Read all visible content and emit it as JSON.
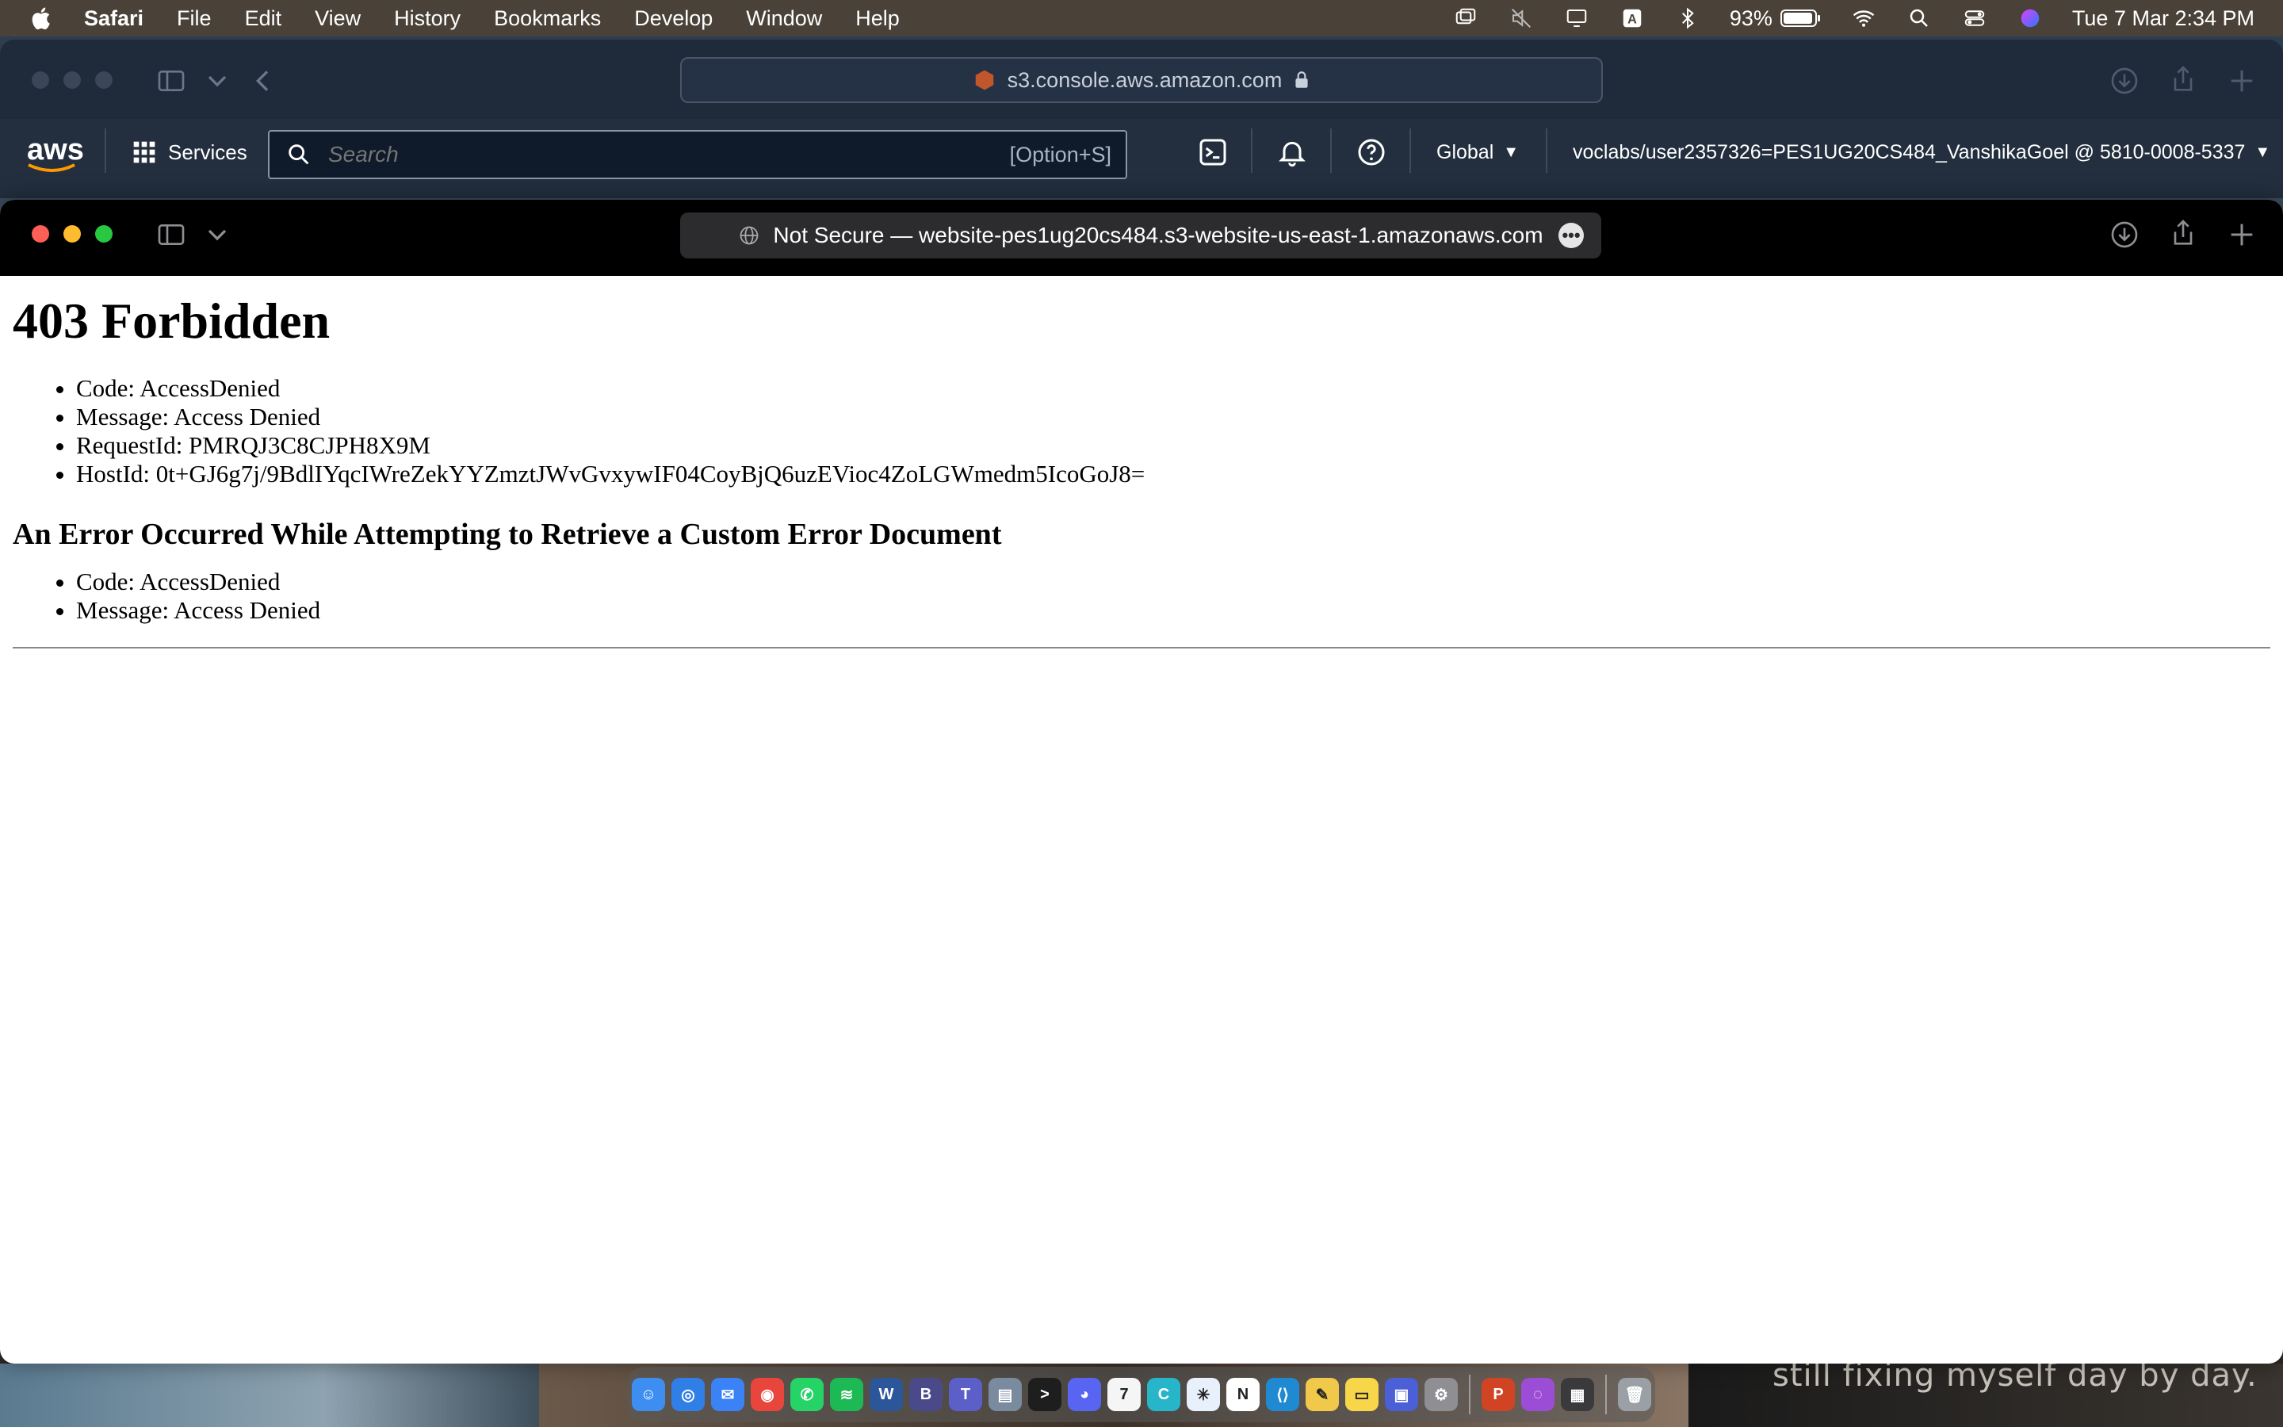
{
  "menubar": {
    "app_name": "Safari",
    "items": [
      "File",
      "Edit",
      "View",
      "History",
      "Bookmarks",
      "Develop",
      "Window",
      "Help"
    ],
    "battery": "93%",
    "datetime": "Tue 7 Mar  2:34 PM"
  },
  "back_window": {
    "url": "s3.console.aws.amazon.com",
    "aws_logo": "aws",
    "services_label": "Services",
    "search_placeholder": "Search",
    "search_hint": "[Option+S]",
    "region": "Global",
    "account": "voclabs/user2357326=PES1UG20CS484_VanshikaGoel @ 5810-0008-5337"
  },
  "front_window": {
    "url": "Not Secure — website-pes1ug20cs484.s3-website-us-east-1.amazonaws.com"
  },
  "page": {
    "title": "403 Forbidden",
    "error_items": [
      "Code: AccessDenied",
      "Message: Access Denied",
      "RequestId: PMRQJ3C8CJPH8X9M",
      "HostId: 0t+GJ6g7j/9BdlIYqcIWreZekYYZmztJWvGvxywIF04CoyBjQ6uzEVioc4ZoLGWmedm5IcoGoJ8="
    ],
    "subtitle": "An Error Occurred While Attempting to Retrieve a Custom Error Document",
    "custom_error_items": [
      "Code: AccessDenied",
      "Message: Access Denied"
    ]
  },
  "wallpaper_text": "still fixing myself day by day.",
  "dock": {
    "apps": [
      {
        "name": "finder",
        "color": "#3d8ef0",
        "glyph": "☺"
      },
      {
        "name": "safari",
        "color": "#2f7fe6",
        "glyph": "◎"
      },
      {
        "name": "mail",
        "color": "#3b82f6",
        "glyph": "✉"
      },
      {
        "name": "chrome",
        "color": "#e8453c",
        "glyph": "◉"
      },
      {
        "name": "whatsapp",
        "color": "#25d366",
        "glyph": "✆"
      },
      {
        "name": "spotify",
        "color": "#1db954",
        "glyph": "≋"
      },
      {
        "name": "word",
        "color": "#2b579a",
        "glyph": "W"
      },
      {
        "name": "bbedit",
        "color": "#4a4a8a",
        "glyph": "B"
      },
      {
        "name": "teams",
        "color": "#5b5fc7",
        "glyph": "T"
      },
      {
        "name": "preview",
        "color": "#7a8ba0",
        "glyph": "▤"
      },
      {
        "name": "terminal",
        "color": "#1e1e1e",
        "glyph": ">"
      },
      {
        "name": "discord",
        "color": "#5865f2",
        "glyph": "◕"
      },
      {
        "name": "calendar",
        "color": "#f5f5f5",
        "glyph": "7"
      },
      {
        "name": "canva",
        "color": "#27b5c9",
        "glyph": "C"
      },
      {
        "name": "snowflake",
        "color": "#e8f0fb",
        "glyph": "✳"
      },
      {
        "name": "notion",
        "color": "#ffffff",
        "glyph": "N"
      },
      {
        "name": "vscode",
        "color": "#1f8ad2",
        "glyph": "⟨⟩"
      },
      {
        "name": "python",
        "color": "#f0c94a",
        "glyph": "✎"
      },
      {
        "name": "notes",
        "color": "#f7d64a",
        "glyph": "▭"
      },
      {
        "name": "screens",
        "color": "#4b5fd6",
        "glyph": "▣"
      },
      {
        "name": "settings",
        "color": "#8e8e93",
        "glyph": "⚙"
      },
      {
        "name": "powerpoint",
        "color": "#d04423",
        "glyph": "P"
      },
      {
        "name": "podcasts",
        "color": "#9b4dd6",
        "glyph": "◌"
      },
      {
        "name": "calculator",
        "color": "#3a3a3c",
        "glyph": "▦"
      },
      {
        "name": "trash",
        "color": "#9aa0a6",
        "glyph": "🗑"
      }
    ]
  }
}
